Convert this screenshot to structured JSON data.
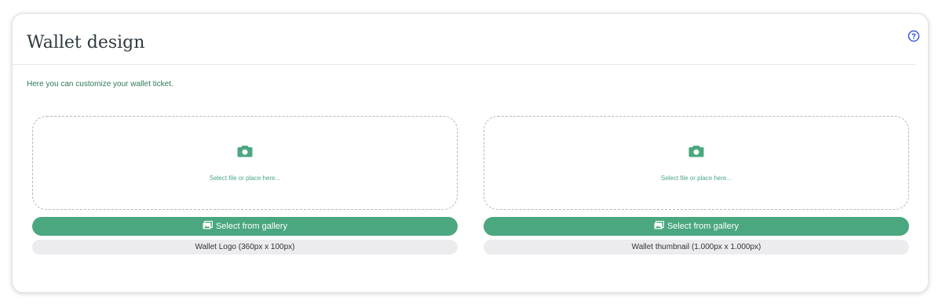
{
  "card": {
    "title": "Wallet design",
    "help_icon": "question-circle-icon",
    "description": "Here you can customize your wallet ticket."
  },
  "uploads": [
    {
      "drop_text": "Select file or place here...",
      "camera_icon": "camera-icon",
      "gallery_label": "Select from gallery",
      "gallery_icon": "image-gallery-icon",
      "spec_label": "Wallet Logo (360px x 100px)"
    },
    {
      "drop_text": "Select file or place here...",
      "camera_icon": "camera-icon",
      "gallery_label": "Select from gallery",
      "gallery_icon": "image-gallery-icon",
      "spec_label": "Wallet thumbnail (1.000px x 1.000px)"
    }
  ],
  "colors": {
    "accent_green": "#4aa77f",
    "help_blue": "#3b5bdb",
    "text_green": "#2d7a57"
  }
}
